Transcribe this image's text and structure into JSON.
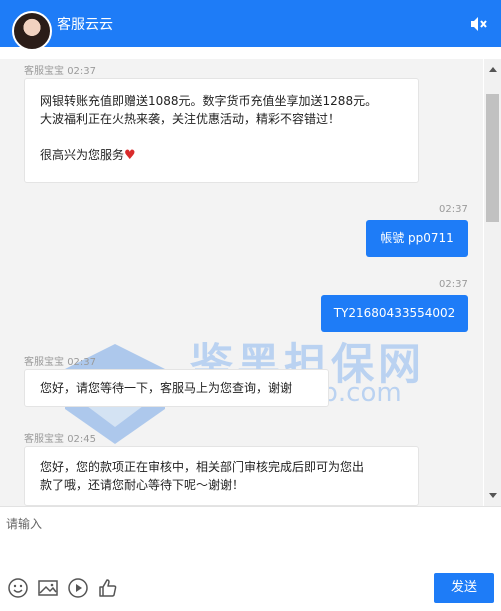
{
  "header": {
    "agent_name": "客服云云",
    "mute_icon": "speaker-mute-icon"
  },
  "messages": [
    {
      "sender": "客服宝宝",
      "time": "02:37",
      "lines": [
        "网银转账充值即赠送1088元。数字货币充值坐享加送1288元。",
        "大波福利正在火热来袭，关注优惠活动，精彩不容错过！",
        "",
        "很高兴为您服务"
      ],
      "icon": "heart-icon"
    },
    {
      "time": "02:37",
      "text": "帳號 pp0711"
    },
    {
      "time": "02:37",
      "text": "TY21680433554002"
    },
    {
      "sender": "客服宝宝",
      "time": "02:37",
      "text": "您好，请您等待一下，客服马上为您查询，谢谢"
    },
    {
      "sender": "客服宝宝",
      "time": "02:45",
      "lines": [
        "您好，您的款项正在审核中，相关部门审核完成后即可为您出",
        "款了哦，还请您耐心等待下呢～谢谢！"
      ]
    }
  ],
  "watermark": {
    "title": "鉴黑担保网",
    "url": "www.jhdbb.com"
  },
  "composer": {
    "placeholder": "请输入",
    "tools": [
      "emoji-icon",
      "image-icon",
      "video-icon",
      "thumbs-up-icon"
    ],
    "send_label": "发送"
  },
  "colors": {
    "accent": "#1e7cf7",
    "chat_background": "#f3f3f3",
    "heart": "#d92b2b"
  }
}
